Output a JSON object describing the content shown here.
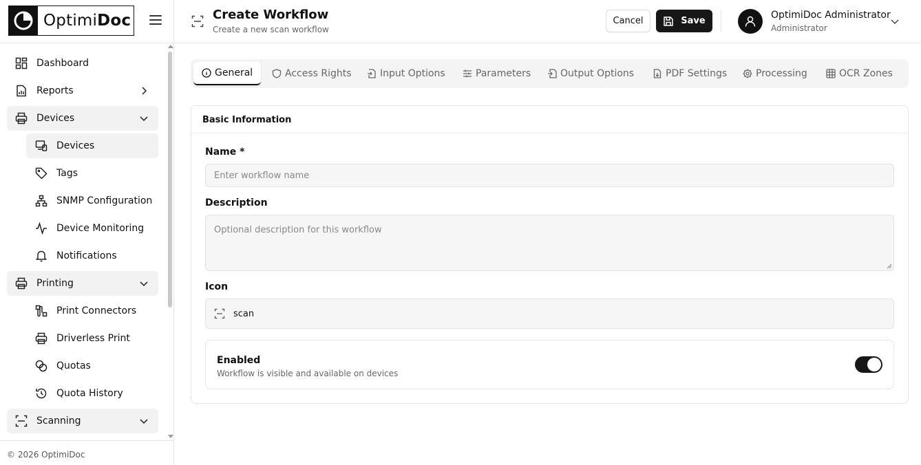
{
  "brand": {
    "name_light": "Optimi",
    "name_bold": "Doc"
  },
  "sidebar": {
    "items": [
      {
        "label": "Dashboard",
        "icon": "dashboard-grid-icon"
      },
      {
        "label": "Reports",
        "icon": "report-chart-icon"
      },
      {
        "label": "Devices",
        "icon": "printer-icon"
      },
      {
        "label": "Devices",
        "icon": "devices-icon"
      },
      {
        "label": "Tags",
        "icon": "tag-icon"
      },
      {
        "label": "SNMP Configuration",
        "icon": "network-icon"
      },
      {
        "label": "Device Monitoring",
        "icon": "activity-icon"
      },
      {
        "label": "Notifications",
        "icon": "bell-icon"
      },
      {
        "label": "Printing",
        "icon": "printer-icon"
      },
      {
        "label": "Print Connectors",
        "icon": "connector-icon"
      },
      {
        "label": "Driverless Print",
        "icon": "printer-icon"
      },
      {
        "label": "Quotas",
        "icon": "coins-icon"
      },
      {
        "label": "Quota History",
        "icon": "history-icon"
      },
      {
        "label": "Scanning",
        "icon": "scan-icon"
      }
    ],
    "footer": "© 2026 OptimiDoc"
  },
  "header": {
    "title": "Create Workflow",
    "subtitle": "Create a new scan workflow",
    "cancel_label": "Cancel",
    "save_label": "Save",
    "user_name": "OptimiDoc Administrator",
    "user_role": "Administrator"
  },
  "tabs": [
    {
      "label": "General",
      "icon": "info-icon",
      "active": true
    },
    {
      "label": "Access Rights",
      "icon": "shield-icon"
    },
    {
      "label": "Input Options",
      "icon": "file-input-icon"
    },
    {
      "label": "Parameters",
      "icon": "sliders-icon"
    },
    {
      "label": "Output Options",
      "icon": "file-output-icon"
    },
    {
      "label": "PDF Settings",
      "icon": "file-pdf-icon"
    },
    {
      "label": "Processing",
      "icon": "cog-icon"
    },
    {
      "label": "OCR Zones",
      "icon": "grid-icon"
    }
  ],
  "form": {
    "section_title": "Basic Information",
    "name_label": "Name *",
    "name_placeholder": "Enter workflow name",
    "name_value": "",
    "description_label": "Description",
    "description_placeholder": "Optional description for this workflow",
    "description_value": "",
    "icon_label": "Icon",
    "icon_value": "scan",
    "enabled_label": "Enabled",
    "enabled_description": "Workflow is visible and available on devices",
    "enabled": true
  },
  "colors": {
    "primary": "#171717",
    "muted_bg": "#f4f4f4",
    "border": "#e5e5e5"
  }
}
